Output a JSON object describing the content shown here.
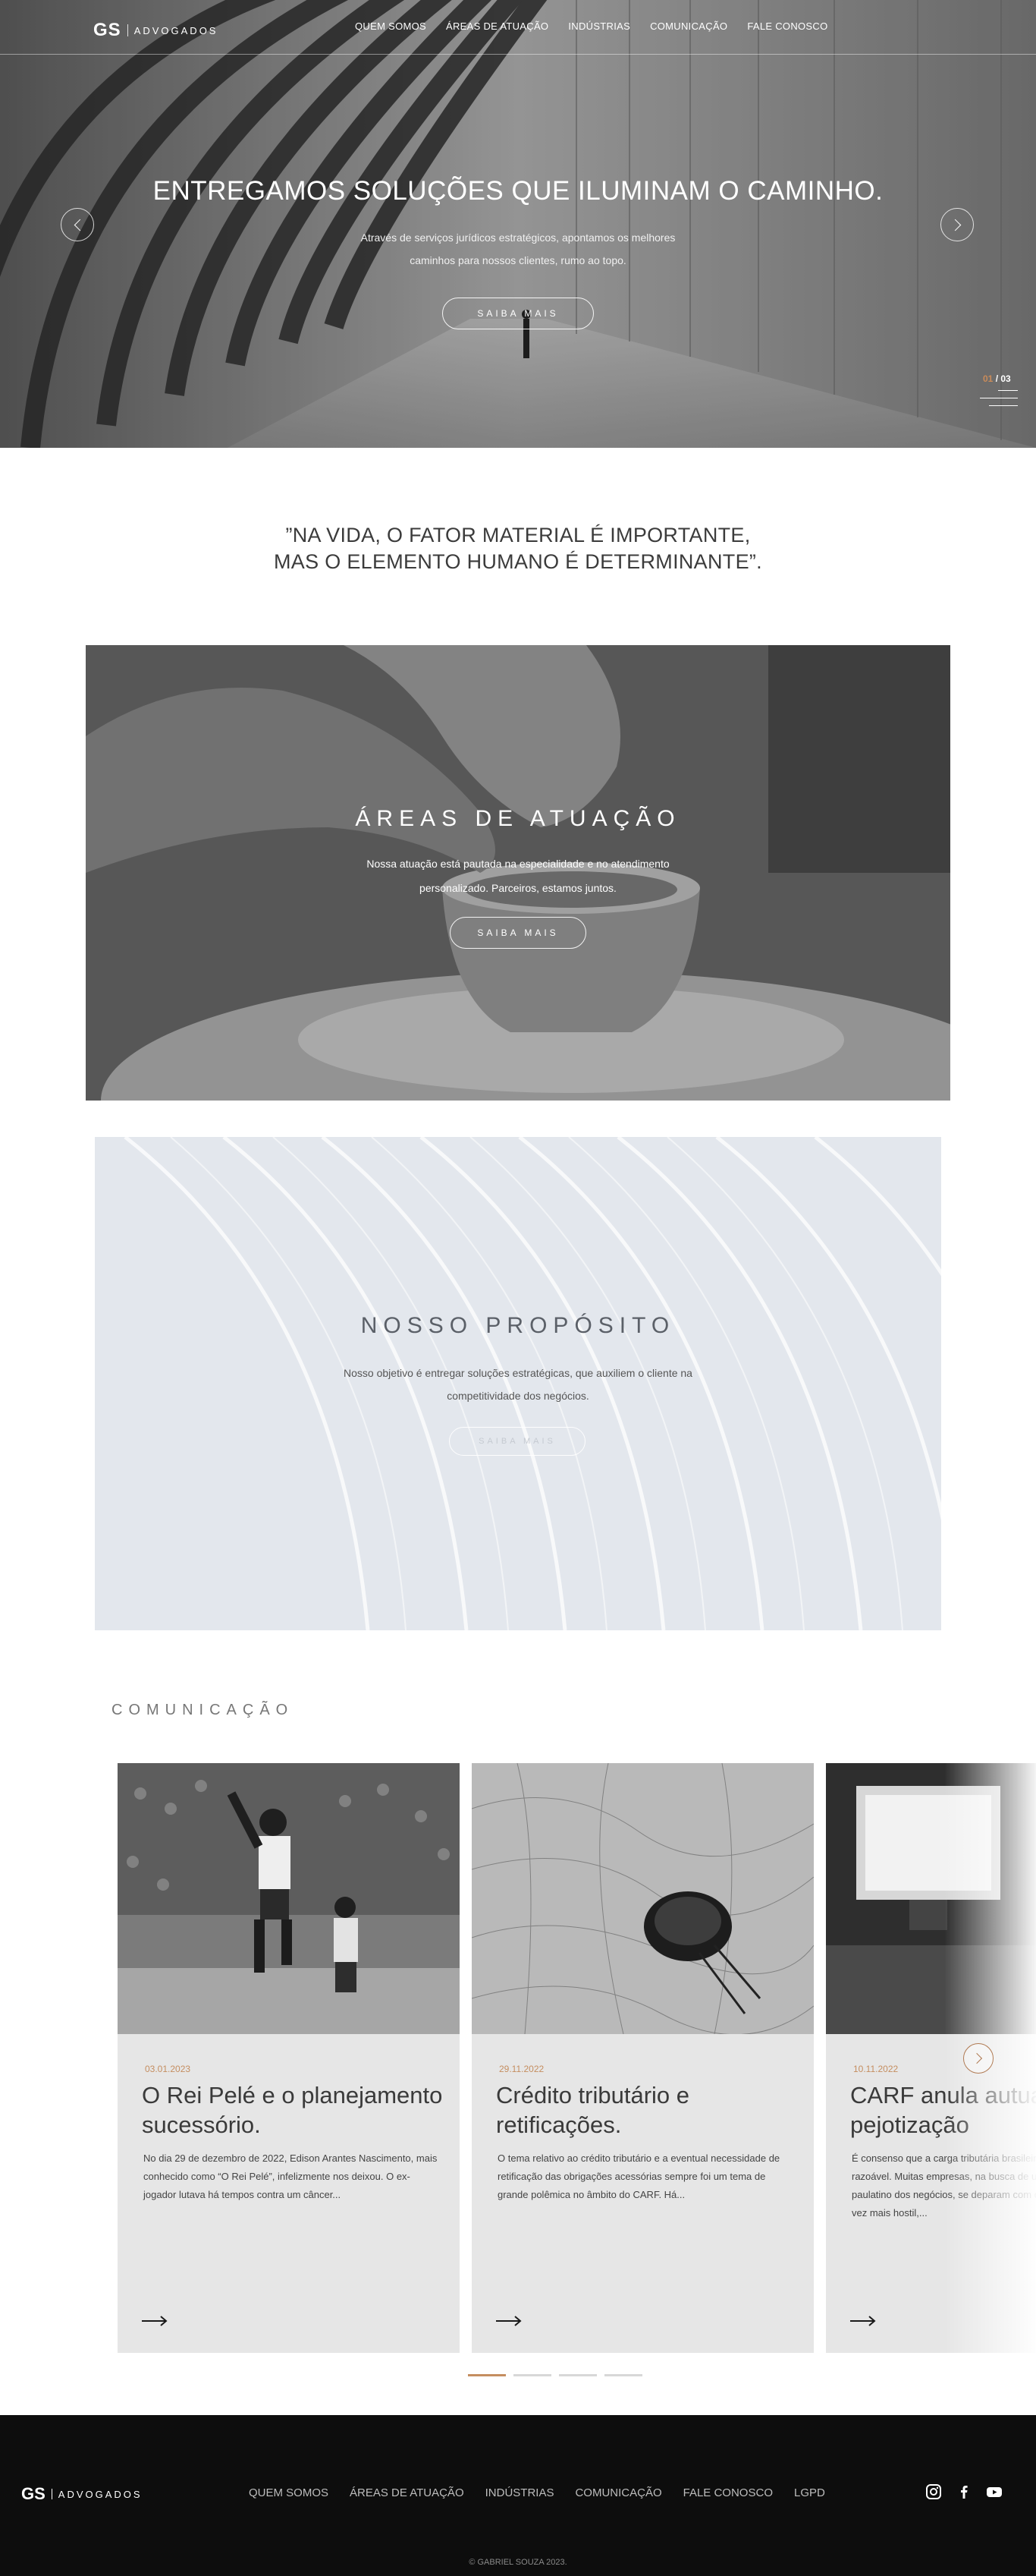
{
  "brand": {
    "initials": "GS",
    "name": "ADVOGADOS"
  },
  "nav": {
    "items": [
      {
        "label": "QUEM SOMOS"
      },
      {
        "label": "ÁREAS DE ATUAÇÃO"
      },
      {
        "label": "INDÚSTRIAS"
      },
      {
        "label": "COMUNICAÇÃO"
      },
      {
        "label": "FALE CONOSCO"
      }
    ]
  },
  "hero": {
    "title": "ENTREGAMOS SOLUÇÕES QUE ILUMINAM O CAMINHO.",
    "subtitle": "Através de serviços jurídicos estratégicos, apontamos os melhores caminhos para nossos clientes, rumo ao topo.",
    "button": "SAIBA MAIS",
    "slide_current": "01",
    "slide_total": "/ 03",
    "icons": {
      "prev": "chevron-left-icon",
      "next": "chevron-right-icon",
      "menu": "hamburger-menu-icon"
    }
  },
  "quote": {
    "line1": "”NA VIDA, O FATOR MATERIAL É IMPORTANTE,",
    "line2": "MAS O ELEMENTO HUMANO É DETERMINANTE”."
  },
  "areas": {
    "title": "ÁREAS DE ATUAÇÃO",
    "subtitle": "Nossa atuação está pautada na especialidade e no atendimento personalizado. Parceiros, estamos juntos.",
    "button": "SAIBA MAIS"
  },
  "proposito": {
    "title": "NOSSO PROPÓSITO",
    "subtitle": "Nosso objetivo é entregar soluções estratégicas, que auxiliem o cliente na competitividade dos negócios.",
    "button": "SAIBA MAIS"
  },
  "comunicacao": {
    "title": "COMUNICAÇÃO",
    "cards": [
      {
        "date": "03.01.2023",
        "title": "O Rei Pelé e o planejamento sucessório.",
        "excerpt": "No dia 29 de dezembro de 2022, Edison Arantes Nascimento, mais conhecido como “O Rei Pelé”, infelizmente nos deixou. O ex-jogador lutava há tempos contra um câncer..."
      },
      {
        "date": "29.11.2022",
        "title": "Crédito tributário e retificações.",
        "excerpt": "O tema relativo ao crédito tributário e a eventual necessidade de retificação das obrigações acessórias sempre foi um tema de grande polêmica no âmbito do CARF. Há..."
      },
      {
        "date": "10.11.2022",
        "title": "CARF anula autuação por pejotização",
        "excerpt": "É consenso que a carga tributária brasileira ultrapassa os limites do razoável. Muitas empresas, na busca de um alívio no fluxo paulatino dos negócios, se deparam com o Fisco tributário cada vez mais hostil,..."
      }
    ],
    "icons": {
      "arrow": "arrow-right-icon",
      "next": "chevron-right-icon"
    },
    "pagination": {
      "total": 4,
      "active": 0
    }
  },
  "footer": {
    "links": [
      {
        "label": "QUEM SOMOS"
      },
      {
        "label": "ÁREAS DE ATUAÇÃO"
      },
      {
        "label": "INDÚSTRIAS"
      },
      {
        "label": "COMUNICAÇÃO"
      },
      {
        "label": "FALE CONOSCO"
      },
      {
        "label": "LGPD"
      }
    ],
    "social": [
      "instagram-icon",
      "facebook-icon",
      "youtube-icon"
    ],
    "copyright": "© GABRIEL SOUZA 2023."
  },
  "colors": {
    "accent": "#c58e60",
    "footer_bg": "#0d0d0d",
    "card_bg": "#e6e6e6",
    "proposito_bg": "#e3e7ed"
  }
}
